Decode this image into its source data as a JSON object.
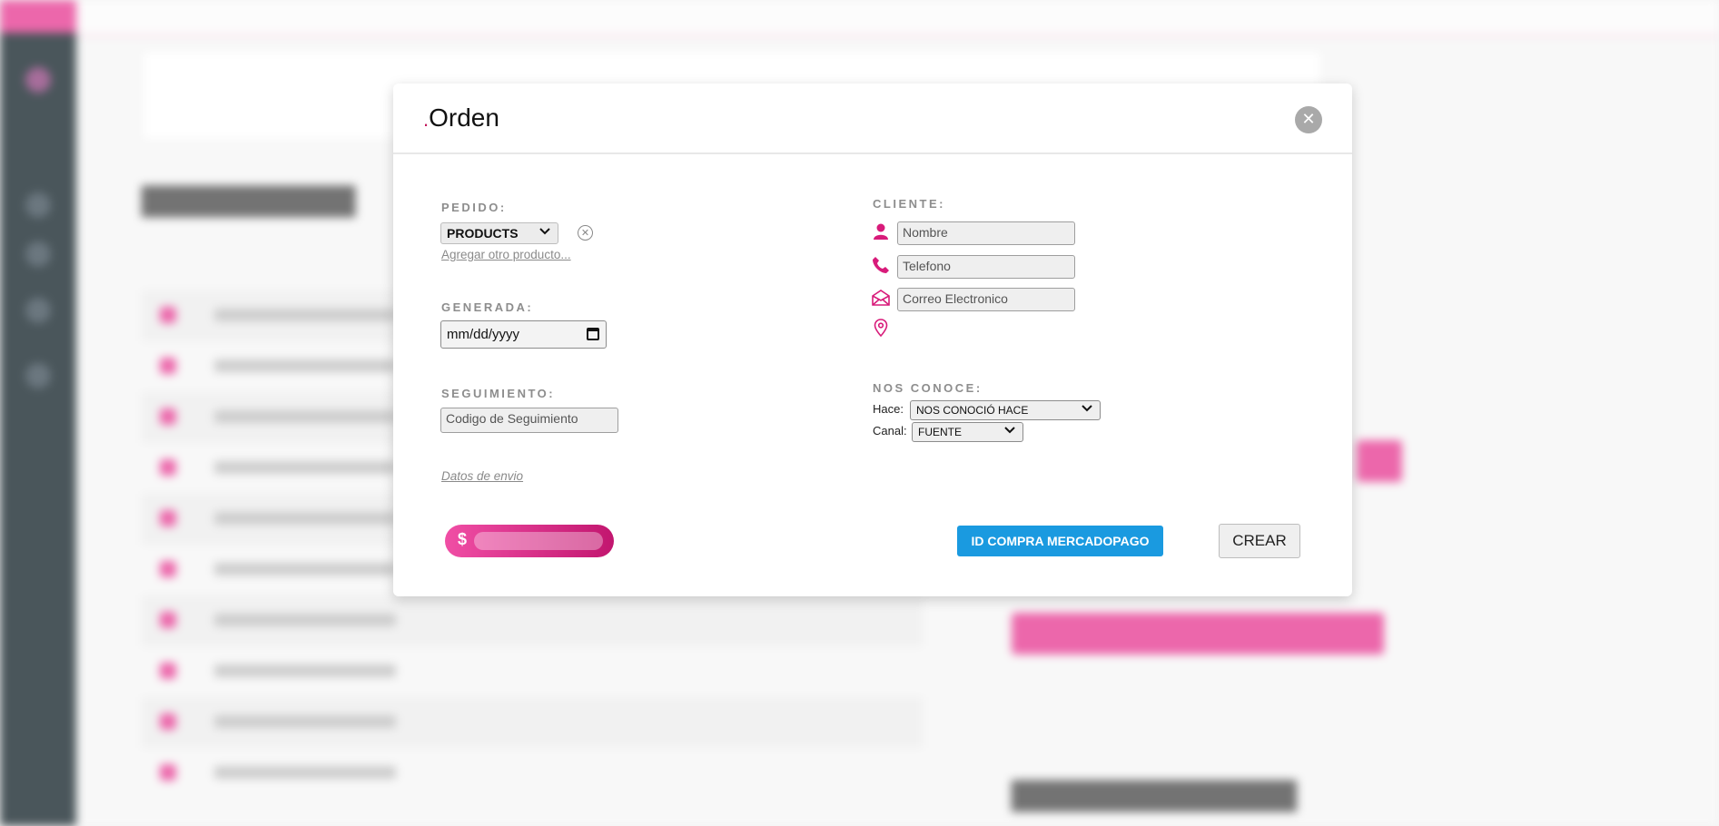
{
  "modal": {
    "title_dot": ".",
    "title": "Orden",
    "close_glyph": "✕"
  },
  "pedido": {
    "label": "PEDIDO:",
    "product_select": "PRODUCTS",
    "add_product_link": "Agregar otro producto..."
  },
  "generada": {
    "label": "GENERADA:",
    "date_placeholder": "mm/dd/yyyy"
  },
  "seguimiento": {
    "label": "SEGUIMIENTO:",
    "placeholder": "Codigo de Seguimiento"
  },
  "datos_envio_link": "Datos de envio",
  "cliente": {
    "label": "CLIENTE:",
    "nombre_placeholder": "Nombre",
    "telefono_placeholder": "Telefono",
    "correo_placeholder": "Correo Electronico"
  },
  "nos_conoce": {
    "label": "NOS CONOCE:",
    "hace_label": "Hace:",
    "hace_value": "NOS CONOCIÓ HACE",
    "canal_label": "Canal:",
    "canal_value": "FUENTE"
  },
  "payment": {
    "currency_symbol": "$"
  },
  "buttons": {
    "mercadopago": "ID COMPRA MERCADOPAGO",
    "crear": "CREAR"
  },
  "colors": {
    "accent_pink": "#e6358f",
    "mercadopago_blue": "#1a9ae0",
    "sidebar_dark": "#0e1e25"
  },
  "icons": {
    "close": "close-icon",
    "remove_product": "remove-circle-icon",
    "calendar": "calendar-icon",
    "person": "person-icon",
    "phone": "phone-icon",
    "mail": "mail-icon",
    "location": "location-pin-icon",
    "chevron": "chevron-down-icon"
  }
}
